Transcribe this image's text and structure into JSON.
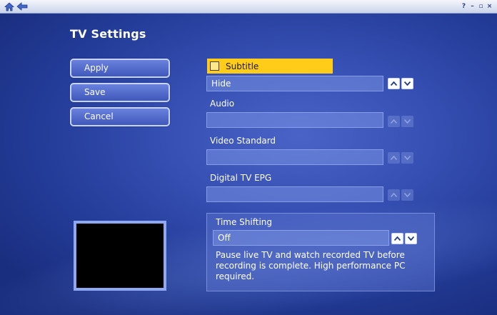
{
  "page": {
    "title": "TV Settings"
  },
  "topbar": {
    "home_icon": "home-icon",
    "back_icon": "back-arrow-icon",
    "controls": {
      "help": "?",
      "minimize": "–",
      "restore": "▫",
      "close": "×"
    }
  },
  "actions": {
    "apply": "Apply",
    "save": "Save",
    "cancel": "Cancel"
  },
  "subtitle": {
    "label": "Subtitle",
    "checked": false,
    "value": "Hide"
  },
  "audio": {
    "label": "Audio",
    "value": ""
  },
  "video_standard": {
    "label": "Video Standard",
    "value": ""
  },
  "digital_tv_epg": {
    "label": "Digital TV EPG",
    "value": ""
  },
  "time_shifting": {
    "label": "Time Shifting",
    "value": "Off",
    "description": "Pause live TV and watch recorded TV before recording is complete. High performance PC required."
  },
  "colors": {
    "highlight": "#ffcc1a",
    "background": "#2b44a3",
    "text": "#ffffff"
  }
}
